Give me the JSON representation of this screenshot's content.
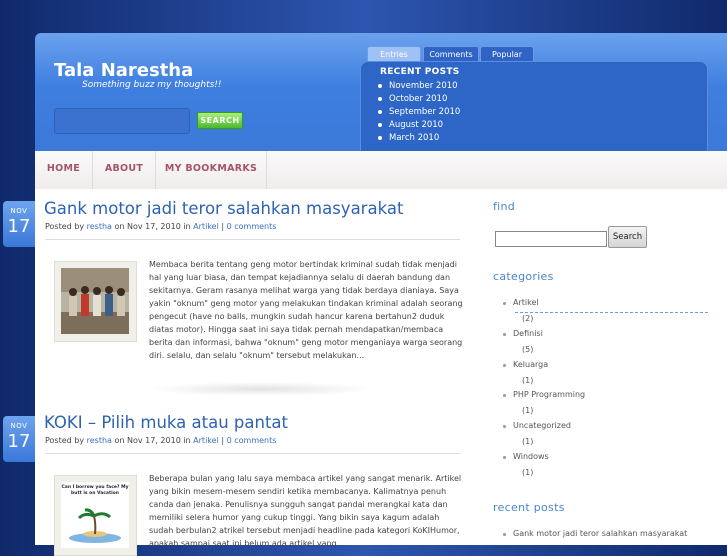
{
  "site": {
    "title": "Tala Narestha",
    "description": "Something buzz my thoughts!!"
  },
  "search": {
    "button": "SEARCH",
    "placeholder": ""
  },
  "tabs": [
    {
      "label": "Entries"
    },
    {
      "label": "Comments"
    },
    {
      "label": "Popular"
    }
  ],
  "recent_box": {
    "heading": "RECENT POSTS",
    "items": [
      "November 2010",
      "October 2010",
      "September 2010",
      "August 2010",
      "March 2010"
    ]
  },
  "nav": [
    {
      "label": "HOME"
    },
    {
      "label": "ABOUT"
    },
    {
      "label": "MY BOOKMARKS"
    }
  ],
  "posts": [
    {
      "month": "NOV",
      "day": "17",
      "title": "Gank motor jadi teror salahkan masyarakat",
      "posted_by": "Posted by",
      "author": "restha",
      "on": "on Nov 17, 2010 in",
      "category": "Artikel",
      "sep": "|",
      "comments": "0 comments",
      "excerpt": "Membaca berita tentang geng motor bertindak kriminal sudah tidak menjadi hal yang luar biasa, dan tempat kejadiannya selalu di daerah bandung dan sekitarnya. Geram rasanya melihat warga yang tidak berdaya dianiaya. Saya yakin \"oknum\" geng motor yang melakukan tindakan kriminal adalah seorang pengecut (have no balls, mungkin sudah hancur karena bertahun2 duduk diatas motor). Hingga saat ini saya tidak pernah mendapatkan/membaca berita dan informasi, bahwa \"oknum\" geng motor menganiaya warga seorang diri. selalu, dan selalu \"oknum\" tersebut melakukan..."
    },
    {
      "month": "NOV",
      "day": "17",
      "title": "KOKI – Pilih muka atau pantat",
      "posted_by": "Posted by",
      "author": "restha",
      "on": "on Nov 17, 2010 in",
      "category": "Artikel",
      "sep": "|",
      "comments": "0 comments",
      "excerpt": "Beberapa bulan yang lalu saya membaca artikel yang sangat menarik. Artikel yang bikin mesem-mesem sendiri ketika membacanya. Kalimatnya penuh canda dan jenaka. Penulisnya sungguh sangat pandai merangkai kata dan memiliki selera humor yang cukup tinggi. Yang bikin saya kagum adalah sudah berbulan2 atrikel tersebut menjadi headline pada kategori KoKIHumor, apakah sampai saat ini belum ada artikel yang..."
    }
  ],
  "sidebar": {
    "find_heading": "find",
    "find_button": "Search",
    "categories_heading": "categories",
    "categories": [
      {
        "name": "Artikel",
        "count": "(2)"
      },
      {
        "name": "Definisi",
        "count": "(5)"
      },
      {
        "name": "Keluarga",
        "count": "(1)"
      },
      {
        "name": "PHP Programming",
        "count": "(1)"
      },
      {
        "name": "Uncategorized",
        "count": "(1)"
      },
      {
        "name": "Windows",
        "count": "(1)"
      }
    ],
    "recent_heading": "recent posts",
    "recent": [
      "Gank motor jadi teror salahkan masyarakat"
    ]
  },
  "thumb2_caption": "Can I borrow you face? My butt is on Vacation",
  "colors": {
    "accent": "#3f7fe0",
    "link": "#2e63b3",
    "nav_text": "#a6546a"
  }
}
